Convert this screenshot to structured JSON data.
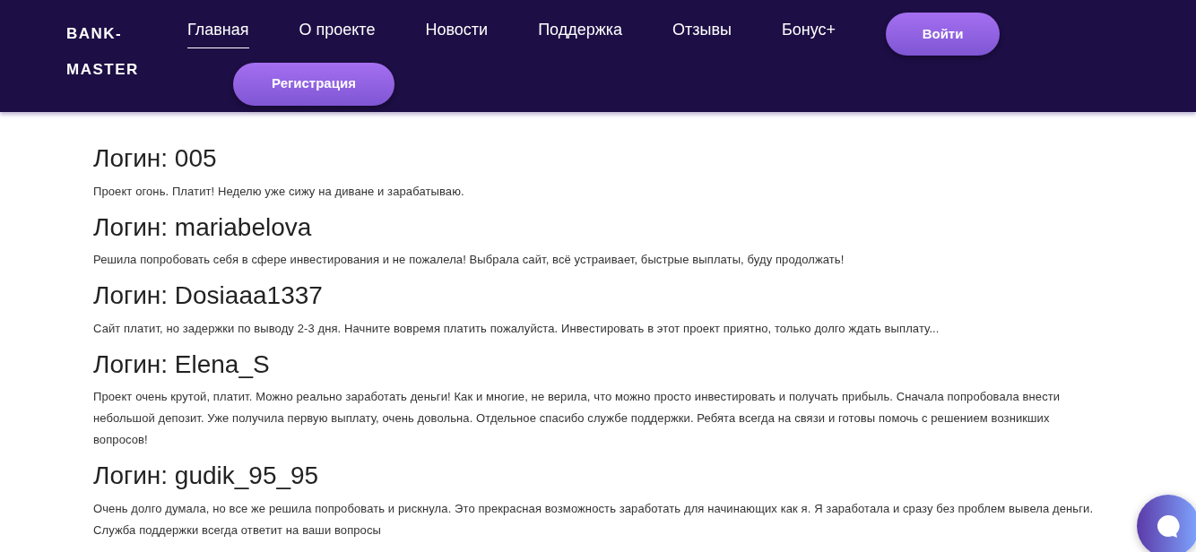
{
  "header": {
    "logo": "BANK-MASTER",
    "nav": [
      {
        "label": "Главная",
        "selected": true
      },
      {
        "label": "О проекте",
        "selected": false
      },
      {
        "label": "Новости",
        "selected": false
      },
      {
        "label": "Поддержка",
        "selected": false
      },
      {
        "label": "Отзывы",
        "selected": false
      },
      {
        "label": "Бонус+",
        "selected": false
      }
    ],
    "buttons": [
      "Войти",
      "Регистрация"
    ]
  },
  "reviews": [
    {
      "login": "Логин: 005",
      "text": "Проект огонь. Платит! Неделю уже сижу на диване и зарабатываю."
    },
    {
      "login": "Логин: mariabelova",
      "text": "Решила попробовать себя в сфере инвестирования и не пожалела! Выбрала сайт, всё устраивает, быстрые выплаты, буду продолжать!"
    },
    {
      "login": "Логин: Dosiaaa1337",
      "text": "Сайт платит, но задержки по выводу 2-3 дня. Начните вовремя платить пожалуйста. Инвестировать в этот проект приятно, только долго ждать выплату..."
    },
    {
      "login": "Логин: Elena_S",
      "text": "Проект очень крутой, платит. Можно реально заработать деньги! Как и многие, не верила, что можно просто инвестировать и получать прибыль. Сначала попробовала внести небольшой депозит. Уже получила первую выплату, очень довольна. Отдельное спасибо службе поддержки. Ребята всегда на связи и готовы помочь с решением возникших вопросов!"
    },
    {
      "login": "Логин: gudik_95_95",
      "text": "Очень долго думала, но все же решила попробовать и рискнула. Это прекрасная возможность заработать для начинающих как я. Я заработала и сразу без проблем вывела деньги. Служба поддержки всегда ответит на ваши вопросы"
    }
  ]
}
